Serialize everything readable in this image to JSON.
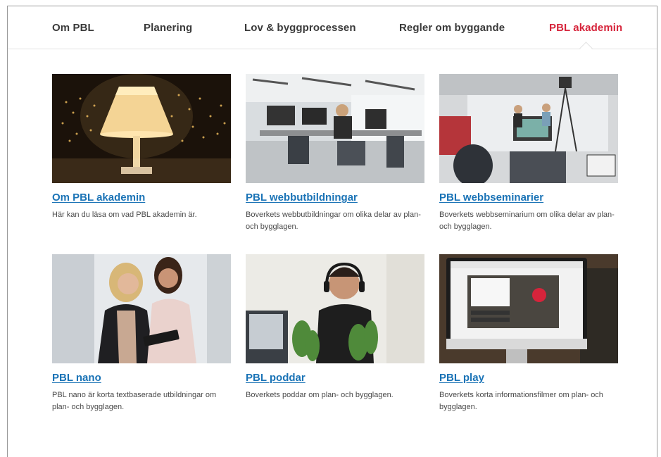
{
  "nav": {
    "items": [
      {
        "label": "Om PBL",
        "active": false
      },
      {
        "label": "Planering",
        "active": false
      },
      {
        "label": "Lov & byggprocessen",
        "active": false
      },
      {
        "label": "Regler om byggande",
        "active": false
      },
      {
        "label": "PBL akademin",
        "active": true
      }
    ]
  },
  "cards": [
    {
      "title": "Om PBL akademin",
      "description": "Här kan du läsa om vad PBL akademin är."
    },
    {
      "title": "PBL webbutbildningar",
      "description": "Boverkets webbutbildningar om olika delar av plan- och bygglagen."
    },
    {
      "title": "PBL webbseminarier",
      "description": "Boverkets webbseminarium om olika delar av plan- och bygglagen."
    },
    {
      "title": "PBL nano",
      "description": "PBL nano är korta textbaserade utbildningar om plan- och bygglagen."
    },
    {
      "title": "PBL poddar",
      "description": "Boverkets poddar om plan- och bygglagen."
    },
    {
      "title": "PBL play",
      "description": "Boverkets korta informationsfilmer om plan- och bygglagen."
    }
  ],
  "colors": {
    "accent": "#d6243b",
    "link": "#1a73b6",
    "nav_text": "#3a3a3a"
  }
}
